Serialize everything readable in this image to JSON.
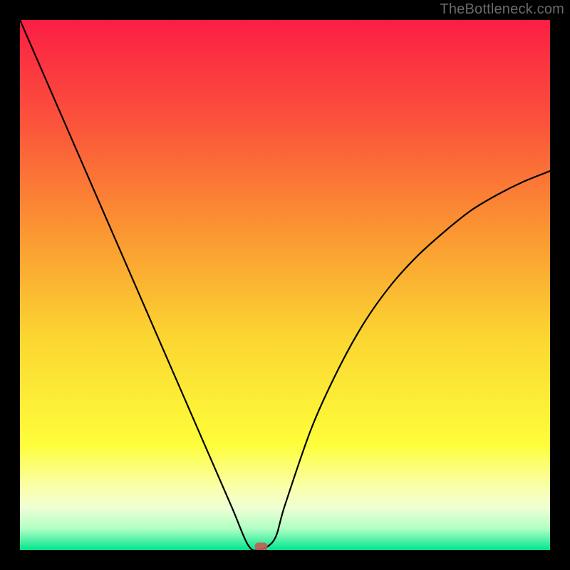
{
  "watermark": "TheBottleneck.com",
  "chart_data": {
    "type": "line",
    "title": "",
    "xlabel": "",
    "ylabel": "",
    "xlim": [
      0,
      1
    ],
    "ylim": [
      0,
      1
    ],
    "series": [
      {
        "name": "curve",
        "x": [
          0.0,
          0.05,
          0.1,
          0.15,
          0.2,
          0.25,
          0.3,
          0.35,
          0.4,
          0.43,
          0.45,
          0.48,
          0.5,
          0.55,
          0.6,
          0.65,
          0.7,
          0.75,
          0.8,
          0.85,
          0.9,
          0.95,
          1.0
        ],
        "values": [
          1.0,
          0.885,
          0.77,
          0.655,
          0.54,
          0.425,
          0.31,
          0.195,
          0.08,
          0.01,
          0.0,
          0.02,
          0.085,
          0.23,
          0.34,
          0.43,
          0.5,
          0.555,
          0.6,
          0.64,
          0.67,
          0.695,
          0.715
        ]
      }
    ],
    "marker": {
      "x": 0.455,
      "y": 0.006
    },
    "background_gradient": {
      "stops": [
        {
          "pos": 0.0,
          "color": "#fb1e44"
        },
        {
          "pos": 0.2,
          "color": "#fb553b"
        },
        {
          "pos": 0.4,
          "color": "#fb9632"
        },
        {
          "pos": 0.6,
          "color": "#fbd631"
        },
        {
          "pos": 0.8,
          "color": "#fefd3a"
        },
        {
          "pos": 0.88,
          "color": "#faffa8"
        },
        {
          "pos": 0.92,
          "color": "#efffd4"
        },
        {
          "pos": 0.96,
          "color": "#b0ffc4"
        },
        {
          "pos": 1.0,
          "color": "#00e58e"
        }
      ]
    }
  }
}
